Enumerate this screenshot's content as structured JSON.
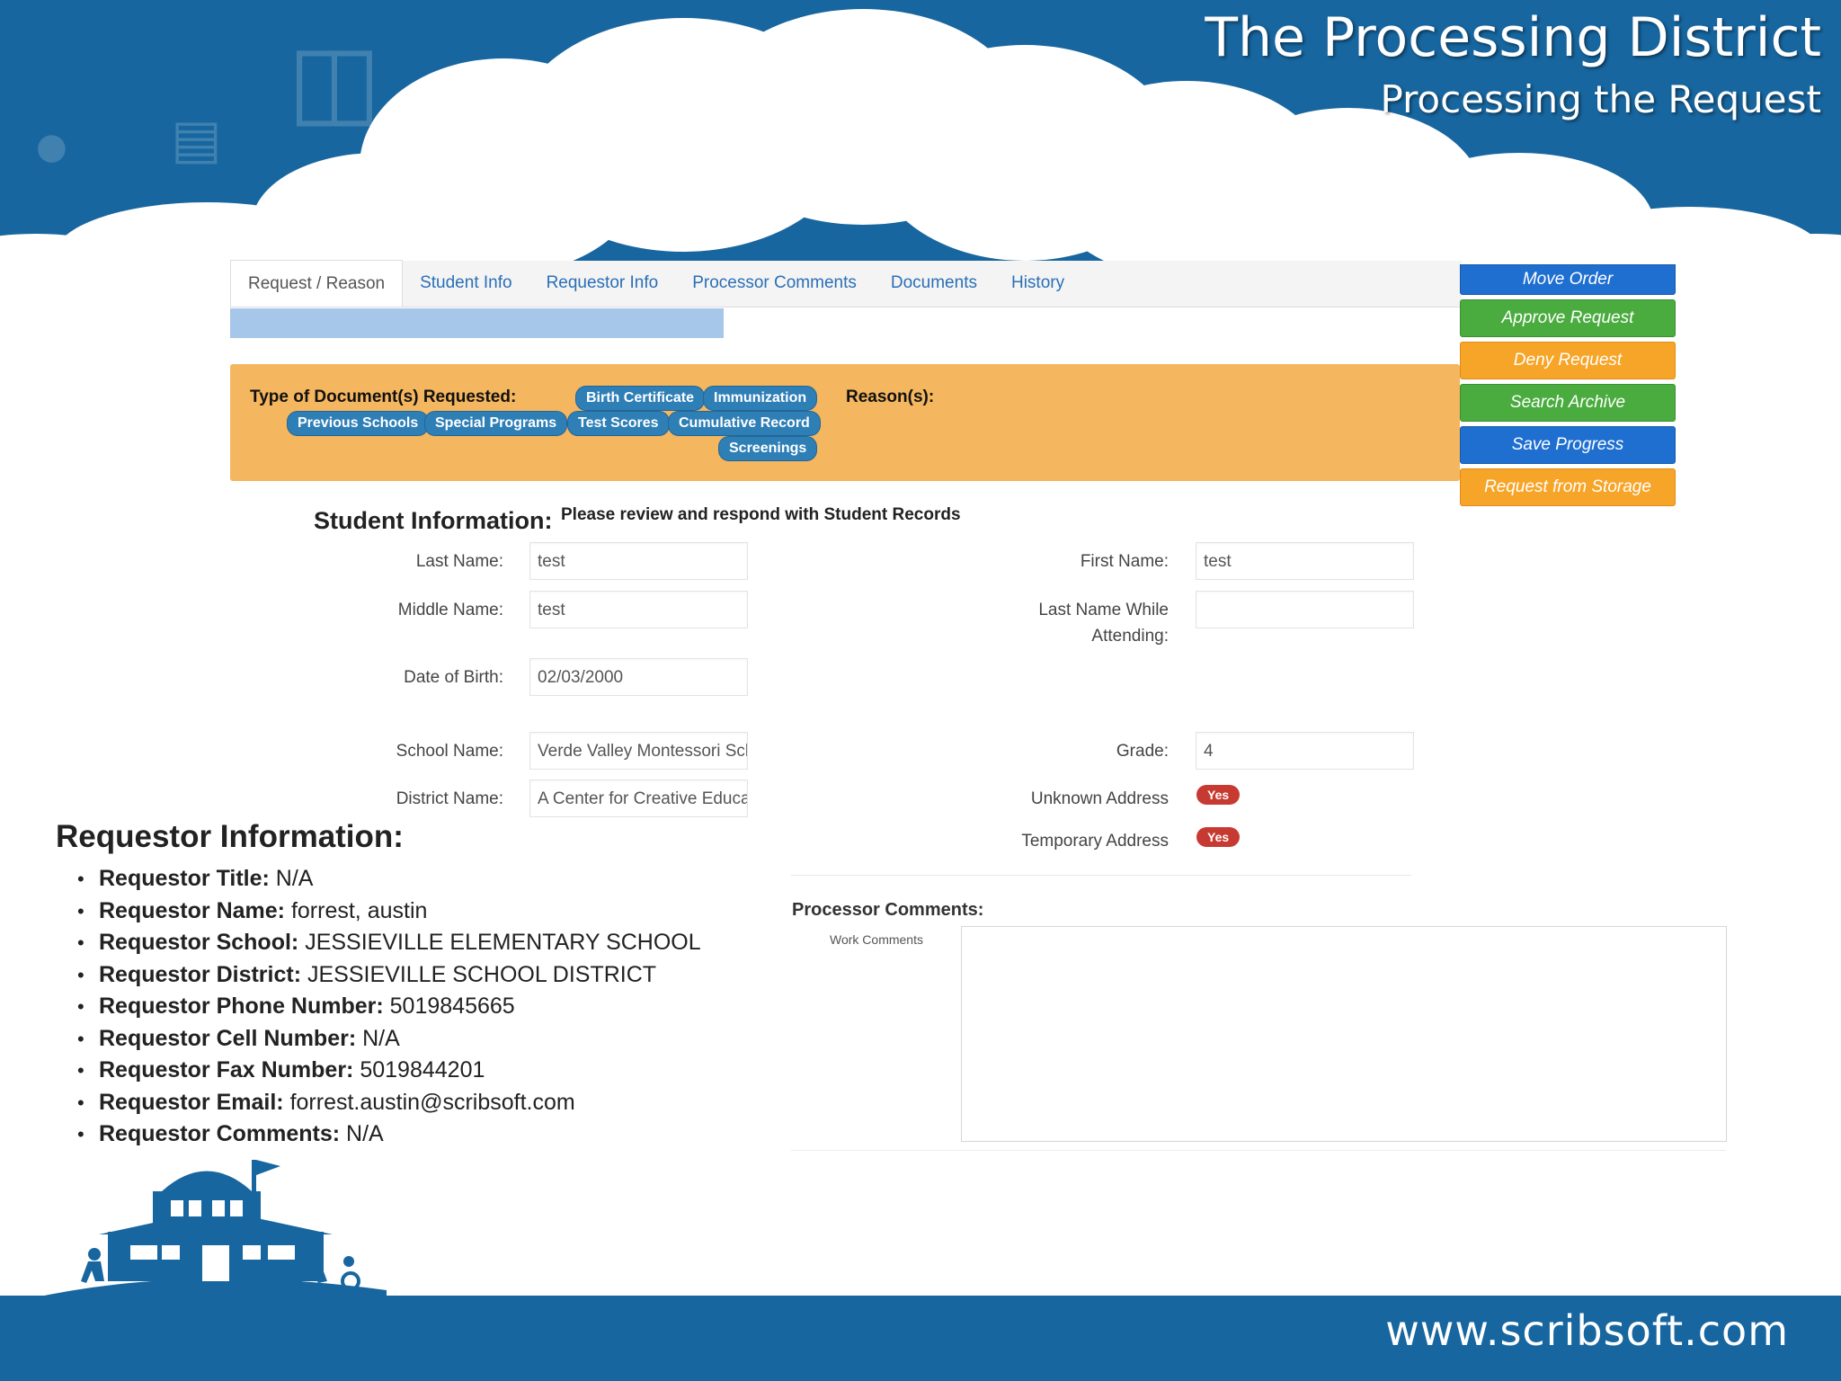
{
  "slide": {
    "title": "The Processing District",
    "subtitle": "Processing the Request",
    "footer_url": "www.scribsoft.com"
  },
  "tabs": [
    {
      "label": "Request / Reason",
      "active": true
    },
    {
      "label": "Student Info",
      "active": false
    },
    {
      "label": "Requestor Info",
      "active": false
    },
    {
      "label": "Processor Comments",
      "active": false
    },
    {
      "label": "Documents",
      "active": false
    },
    {
      "label": "History",
      "active": false
    }
  ],
  "actions": {
    "move_order": "Move Order",
    "approve_request": "Approve Request",
    "deny_request": "Deny Request",
    "search_archive": "Search Archive",
    "save_progress": "Save Progress",
    "request_from_storage": "Request from Storage"
  },
  "request_panel": {
    "doc_label": "Type of Document(s) Requested:",
    "reason_label": "Reason(s):",
    "documents": [
      "Birth Certificate",
      "Immunization",
      "Previous Schools",
      "Special Programs",
      "Test Scores",
      "Cumulative Record",
      "Screenings"
    ]
  },
  "student": {
    "title": "Student Information:",
    "note": "Please review and respond with Student Records",
    "last_name_label": "Last Name:",
    "last_name": "test",
    "first_name_label": "First Name:",
    "first_name": "test",
    "middle_name_label": "Middle Name:",
    "middle_name": "test",
    "last_name_attending_label_1": "Last Name While",
    "last_name_attending_label_2": "Attending:",
    "last_name_attending": "",
    "dob_label": "Date of Birth:",
    "dob": "02/03/2000",
    "school_name_label": "School Name:",
    "school_name": "Verde Valley Montessori School",
    "grade_label": "Grade:",
    "grade": "4",
    "district_name_label": "District Name:",
    "district_name": "A Center for Creative Education",
    "unknown_address_label": "Unknown Address",
    "unknown_address": "Yes",
    "temporary_address_label": "Temporary Address",
    "temporary_address": "Yes"
  },
  "requestor": {
    "title": "Requestor Information:",
    "items": [
      {
        "label": "Requestor Title:",
        "value": "N/A"
      },
      {
        "label": "Requestor Name:",
        "value": "forrest, austin"
      },
      {
        "label": "Requestor School:",
        "value": "JESSIEVILLE ELEMENTARY SCHOOL"
      },
      {
        "label": "Requestor District:",
        "value": "JESSIEVILLE SCHOOL DISTRICT"
      },
      {
        "label": "Requestor Phone Number:",
        "value": "5019845665"
      },
      {
        "label": "Requestor Cell Number:",
        "value": "N/A"
      },
      {
        "label": "Requestor Fax Number:",
        "value": "5019844201"
      },
      {
        "label": "Requestor Email:",
        "value": "forrest.austin@scribsoft.com"
      },
      {
        "label": "Requestor Comments:",
        "value": "N/A"
      }
    ]
  },
  "processor": {
    "title": "Processor Comments:",
    "work_comments_label": "Work Comments",
    "work_comments": ""
  },
  "colors": {
    "brand_blue": "#17669f",
    "panel_orange": "#f4b65e",
    "chip_blue": "#2f7fb7",
    "action_blue": "#1f6fd1",
    "action_green": "#4aac3f",
    "action_orange": "#f7a528",
    "badge_red": "#c73a32"
  }
}
